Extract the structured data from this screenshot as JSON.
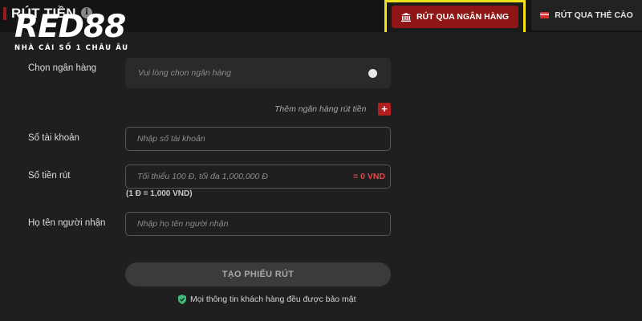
{
  "header": {
    "title": "RÚT TIỀN",
    "info_icon": "info-icon",
    "info_glyph": "i"
  },
  "logo": {
    "brand": "RED88",
    "tagline": "NHÀ CÁI SỐ 1 CHÂU ÂU"
  },
  "tabs": [
    {
      "label": "RÚT QUA NGÂN HÀNG",
      "icon": "bank-icon",
      "active": true
    },
    {
      "label": "RÚT QUA THẺ CÀO",
      "icon": "card-icon",
      "active": false
    }
  ],
  "form": {
    "bank": {
      "label": "Chọn ngân hàng",
      "placeholder": "Vui lòng chọn ngân hàng"
    },
    "add_bank": {
      "label": "Thêm ngân hàng rút tiền",
      "button": "+"
    },
    "account_number": {
      "label": "Số tài khoản",
      "placeholder": "Nhập số tài khoản"
    },
    "amount": {
      "label": "Số tiền rút",
      "placeholder": "Tối thiểu 100 Đ, tối đa 1,000,000 Đ",
      "converted": "= 0 VND",
      "rate_note": "(1 Đ = 1,000 VND)"
    },
    "recipient_name": {
      "label": "Họ tên người nhận",
      "placeholder": "Nhập họ tên người nhận"
    },
    "submit_label": "TẠO PHIẾU RÚT",
    "security_note": "Mọi thông tin khách hàng đều được bảo mật"
  },
  "colors": {
    "accent_red": "#8e1616",
    "highlight_yellow": "#f3e21a",
    "amount_red": "#e04848",
    "shield_green": "#3fb97a"
  }
}
